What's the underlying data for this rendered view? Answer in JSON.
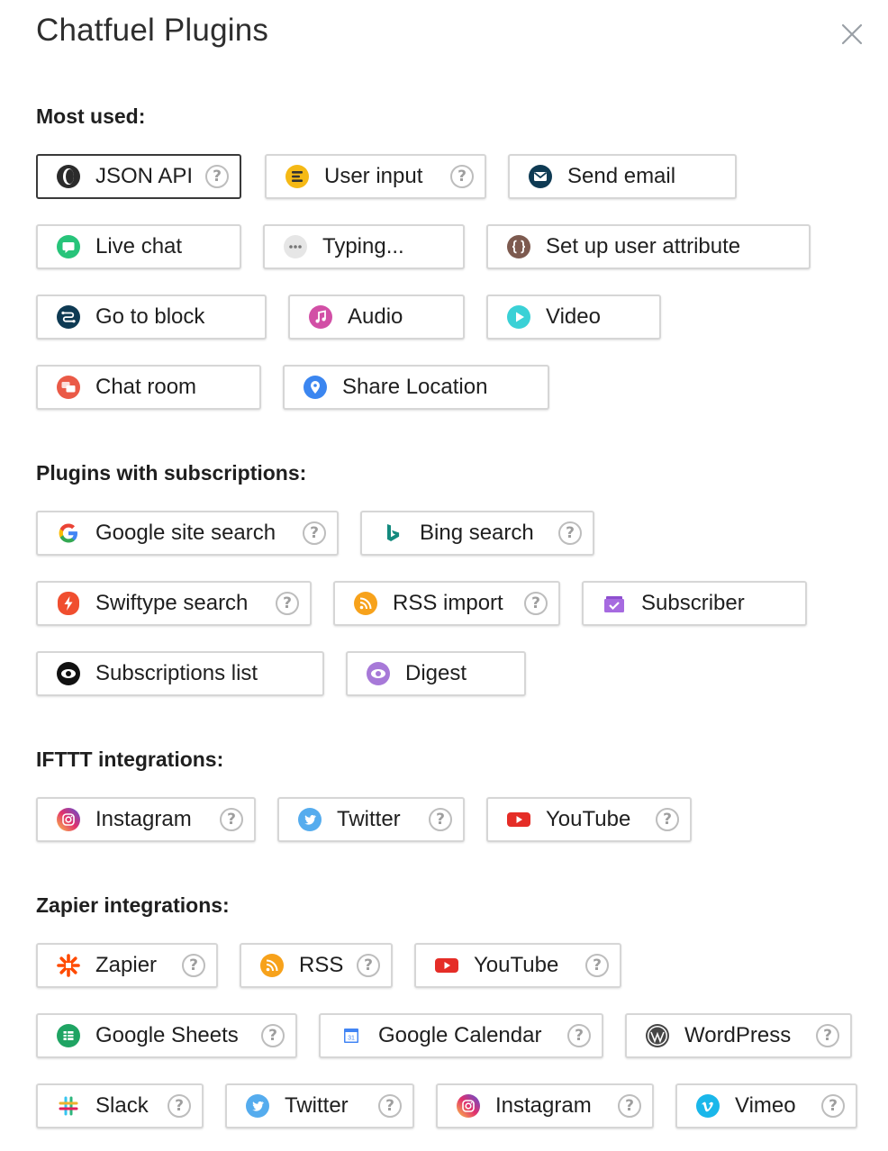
{
  "title": "Chatfuel Plugins",
  "sections": {
    "most_used": "Most used:",
    "subscriptions": "Plugins with subscriptions:",
    "ifttt": "IFTTT integrations:",
    "zapier": "Zapier integrations:"
  },
  "help_glyph": "?",
  "plugins": {
    "json_api": "JSON API",
    "user_input": "User input",
    "send_email": "Send email",
    "live_chat": "Live chat",
    "typing": "Typing...",
    "set_up_user_attribute": "Set up user attribute",
    "go_to_block": "Go to block",
    "audio": "Audio",
    "video": "Video",
    "chat_room": "Chat room",
    "share_location": "Share Location",
    "google_site_search": "Google site search",
    "bing_search": "Bing search",
    "swiftype_search": "Swiftype search",
    "rss_import": "RSS import",
    "subscriber": "Subscriber",
    "subscriptions_list": "Subscriptions list",
    "digest": "Digest",
    "ifttt_instagram": "Instagram",
    "ifttt_twitter": "Twitter",
    "ifttt_youtube": "YouTube",
    "zapier": "Zapier",
    "zapier_rss": "RSS",
    "zapier_youtube": "YouTube",
    "google_sheets": "Google Sheets",
    "google_calendar": "Google Calendar",
    "wordpress": "WordPress",
    "slack": "Slack",
    "zapier_twitter": "Twitter",
    "zapier_instagram": "Instagram",
    "vimeo": "Vimeo"
  },
  "calendar_day": "31",
  "colors": {
    "selected_border": "#3a3a3a",
    "button_border": "#d6d6d6",
    "help_icon": "#bdbdbd",
    "youtube_red": "#e52d27",
    "twitter_blue": "#55acee",
    "rss_orange": "#f7a21b"
  }
}
